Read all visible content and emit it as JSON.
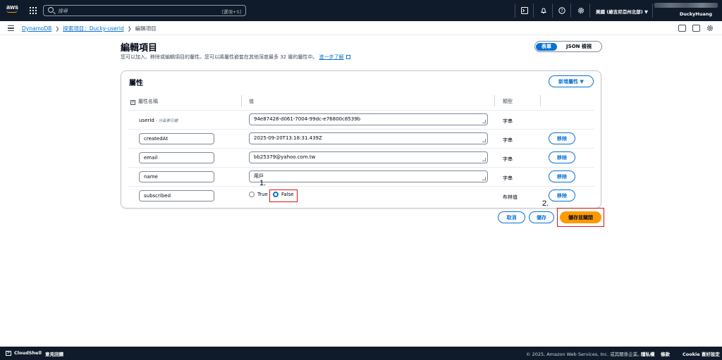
{
  "topbar": {
    "logo": "aws",
    "search_placeholder": "搜尋",
    "search_shortcut": "[選項+S]",
    "region": "美國 (維吉尼亞州北部) ▼",
    "user": "DuckyHuang"
  },
  "breadcrumb": {
    "items": [
      "DynamoDB",
      "探索項目：Ducky-userid",
      "編輯項目"
    ]
  },
  "header": {
    "title": "編輯項目",
    "description": "您可以加入、移除或編輯項目的屬性。您可以將屬性嵌套在其他深度最多 32 層的屬性中。",
    "learn_more": "進一步了解",
    "view_form": "表單",
    "view_json": "JSON 檢視"
  },
  "panel": {
    "title": "屬性",
    "add_button": "新增屬性",
    "columns": {
      "name": "屬性名稱",
      "value": "值",
      "type": "類型"
    },
    "rows": [
      {
        "key": "userId",
        "key_hint": "- 分區索引鍵",
        "value": "94e87428-d061-7004-99dc-e76800c8539b",
        "type": "字串"
      },
      {
        "key": "createdAt",
        "value": "2025-09-20T13:18:31.439Z",
        "type": "字串",
        "remove": "移除"
      },
      {
        "key": "email",
        "value": "bb25379@yahoo.com.tw",
        "type": "字串",
        "remove": "移除"
      },
      {
        "key": "name",
        "value": "用戶",
        "type": "字串",
        "remove": "移除"
      },
      {
        "key": "subscribed",
        "radio_true": "True",
        "radio_false": "False",
        "selected": "False",
        "type": "布林值",
        "remove": "移除"
      }
    ]
  },
  "annotations": {
    "one": "1.",
    "two": "2."
  },
  "actions": {
    "cancel": "取消",
    "save": "儲存",
    "save_close": "儲存並關閉"
  },
  "footer": {
    "cloudshell": "CloudShell",
    "feedback": "意見回饋",
    "copyright": "© 2025, Amazon Web Services, Inc. 或其關係企業。",
    "privacy": "隱私權",
    "terms": "條款",
    "cookie": "Cookie 喜好設定"
  },
  "colors": {
    "accent": "#0972d3",
    "primary_button": "#ff9900",
    "header_bg": "#0f1b2a",
    "highlight": "#d91515"
  }
}
